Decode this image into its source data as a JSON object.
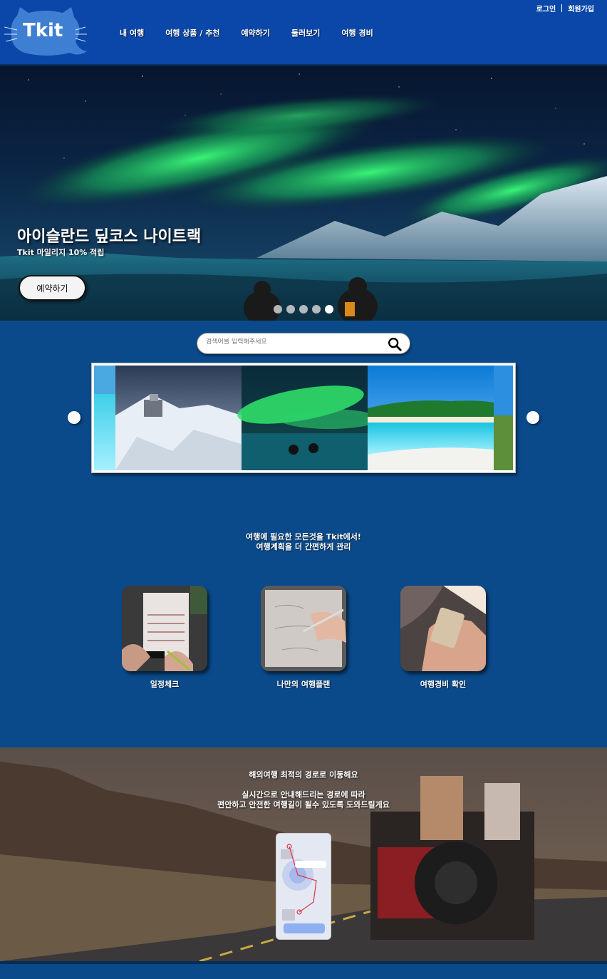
{
  "header": {
    "logo_text": "Tkit",
    "auth": {
      "login": "로그인",
      "signup": "회원가입"
    },
    "nav": [
      "내 여행",
      "여행 상품 / 추천",
      "예약하기",
      "둘러보기",
      "여행 경비"
    ]
  },
  "hero": {
    "title": "아이슬란드 딮코스 나이트랙",
    "subtitle": "Tkit 마일리지 10% 적립",
    "button": "예약하기",
    "slides": 5,
    "active_slide": 5
  },
  "search": {
    "placeholder": "검색어를 입력해주세요"
  },
  "features": {
    "headline_1": "여행에 필요한 모든것을 Tkit에서!",
    "headline_2": "여행계획을 더 간편하게 관리",
    "items": [
      {
        "label": "일정체크",
        "icon": "calendar-photo"
      },
      {
        "label": "나만의 여행플랜",
        "icon": "writing-photo"
      },
      {
        "label": "여행경비 확인",
        "icon": "phone-photo"
      }
    ]
  },
  "route": {
    "title": "해외여행 최적의 경로로 이동해요",
    "desc_1": "실시간으로 안내해드리는 경로에 따라",
    "desc_2": "편안하고 안전한 여행길이 될수 있도록 도와드릴게요"
  },
  "colors": {
    "header": "#0a47a8",
    "body": "#0a4a8a",
    "aurora": "#2dd36f"
  }
}
